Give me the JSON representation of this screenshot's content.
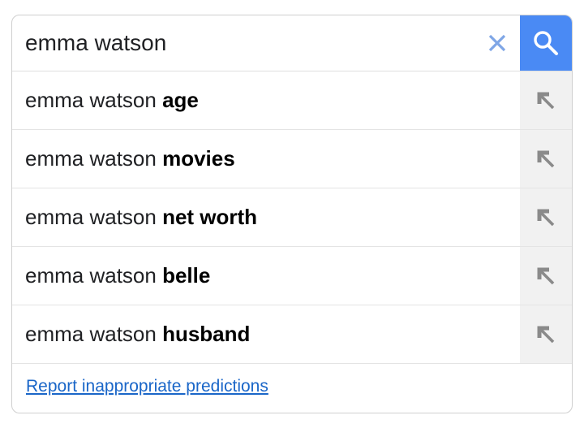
{
  "search": {
    "value": "emma watson",
    "clear_icon": "close-icon",
    "search_icon": "magnifier-icon",
    "accent_color": "#4a8af4"
  },
  "suggestions": [
    {
      "prefix": "emma watson ",
      "completion": "age"
    },
    {
      "prefix": "emma watson ",
      "completion": "movies"
    },
    {
      "prefix": "emma watson ",
      "completion": "net worth"
    },
    {
      "prefix": "emma watson ",
      "completion": "belle"
    },
    {
      "prefix": "emma watson ",
      "completion": "husband"
    }
  ],
  "suggestion_fill_icon": "arrow-up-left-icon",
  "footer": {
    "report_link": "Report inappropriate predictions",
    "link_color": "#1a66c8"
  }
}
